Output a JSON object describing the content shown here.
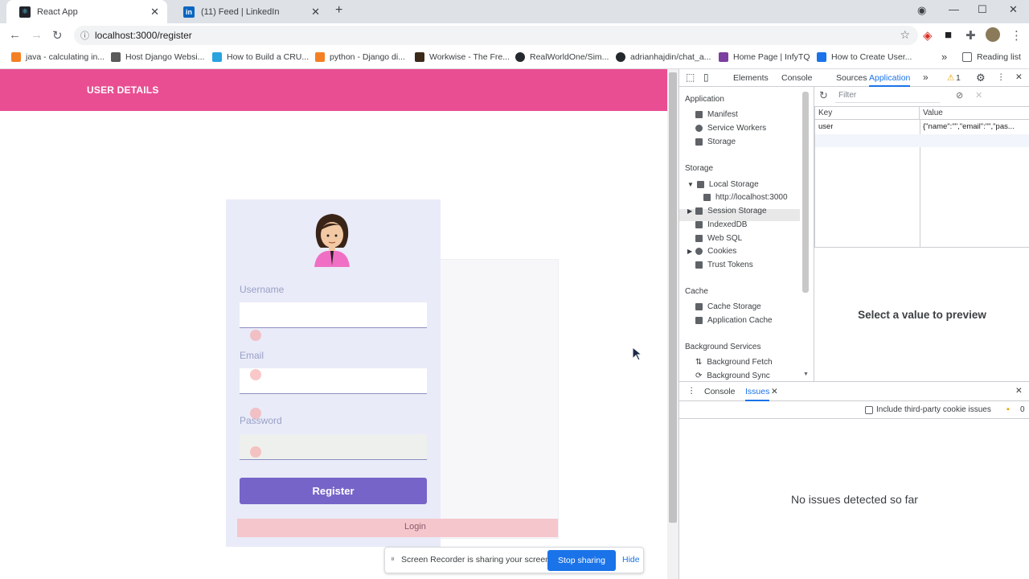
{
  "browser": {
    "tabs": [
      {
        "title": "React App",
        "icon": "react-icon"
      },
      {
        "title": "(11) Feed | LinkedIn",
        "icon": "linkedin-icon"
      }
    ],
    "new_tab_glyph": "+",
    "url": "localhost:3000/register",
    "bookmarks": [
      {
        "label": "java - calculating in...",
        "icon": "stackoverflow-icon",
        "color": "#f48024"
      },
      {
        "label": "Host Django Websi...",
        "icon": "site-icon",
        "color": "#5a5a5a"
      },
      {
        "label": "How to Build a CRU...",
        "icon": "site-icon",
        "color": "#2aa3df"
      },
      {
        "label": "python - Django di...",
        "icon": "stackoverflow-icon",
        "color": "#f48024"
      },
      {
        "label": "Workwise - The Fre...",
        "icon": "site-icon",
        "color": "#3b2a1a"
      },
      {
        "label": "RealWorldOne/Sim...",
        "icon": "github-icon",
        "color": "#24292e"
      },
      {
        "label": "adrianhajdin/chat_a...",
        "icon": "github-icon",
        "color": "#24292e"
      },
      {
        "label": "Home Page | InfyTQ",
        "icon": "site-icon",
        "color": "#7b3fa0"
      },
      {
        "label": "How to Create User...",
        "icon": "site-icon",
        "color": "#1a73e8"
      }
    ],
    "overflow_glyph": "»",
    "reading_list": "Reading list"
  },
  "page": {
    "header_title": "USER DETAILS",
    "fields": [
      {
        "label": "Username"
      },
      {
        "label": "Email"
      },
      {
        "label": "Password"
      }
    ],
    "register_label": "Register",
    "login_label": "Login",
    "accent": "#e94e92",
    "button_color": "#7764c8"
  },
  "devtools": {
    "tabs": [
      "Elements",
      "Console",
      "Sources",
      "Application"
    ],
    "active_tab": "Application",
    "more_glyph": "»",
    "warning_count": "1",
    "sidebar": {
      "application_header": "Application",
      "application_items": [
        "Manifest",
        "Service Workers",
        "Storage"
      ],
      "storage_header": "Storage",
      "storage_items": [
        "Local Storage",
        "http://localhost:3000",
        "Session Storage",
        "IndexedDB",
        "Web SQL",
        "Cookies",
        "Trust Tokens"
      ],
      "cache_header": "Cache",
      "cache_items": [
        "Cache Storage",
        "Application Cache"
      ],
      "bg_header": "Background Services",
      "bg_items": [
        "Background Fetch",
        "Background Sync"
      ]
    },
    "filter_placeholder": "Filter",
    "table": {
      "key_header": "Key",
      "value_header": "Value",
      "row_key": "user",
      "row_value": "{\"name\":\"\",\"email\":\"\",\"pas..."
    },
    "preview_message": "Select a value to preview",
    "drawer": {
      "tabs": [
        "Console",
        "Issues"
      ],
      "active_tab": "Issues",
      "checkbox_label": "Include third-party cookie issues",
      "issue_count": "0",
      "empty_message": "No issues detected so far"
    }
  },
  "share_bar": {
    "text": "Screen Recorder is sharing your screen.",
    "stop_label": "Stop sharing",
    "hide_label": "Hide"
  }
}
